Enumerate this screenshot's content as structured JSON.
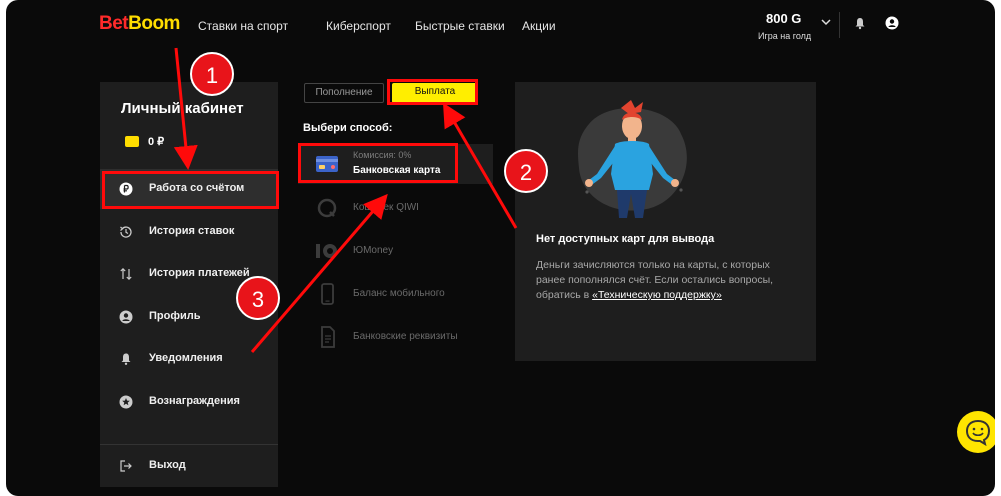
{
  "header": {
    "logo_bet": "Bet",
    "logo_boom": "Boom",
    "nav": [
      "Ставки на спорт",
      "Киберспорт",
      "Быстрые ставки",
      "Акции"
    ],
    "balance_amount": "800 G",
    "balance_sub": "Игра на голд"
  },
  "sidebar": {
    "title": "Личный кабинет",
    "wallet_amount": "0 ₽",
    "items": [
      {
        "label": "Работа со счётом",
        "icon": "ruble-coin-icon"
      },
      {
        "label": "История ставок",
        "icon": "history-icon"
      },
      {
        "label": "История платежей",
        "icon": "transfer-arrows-icon"
      },
      {
        "label": "Профиль",
        "icon": "profile-icon"
      },
      {
        "label": "Уведомления",
        "icon": "bell-icon"
      },
      {
        "label": "Вознаграждения",
        "icon": "star-icon"
      },
      {
        "label": "Выход",
        "icon": "logout-icon"
      }
    ]
  },
  "tabs": {
    "deposit": "Пополнение",
    "withdraw": "Выплата"
  },
  "choose_label": "Выбери способ:",
  "methods": [
    {
      "name": "Банковская карта",
      "fee": "Комиссия: 0%",
      "icon": "bank-card-icon"
    },
    {
      "name": "Кошелек QIWI",
      "icon": "qiwi-icon"
    },
    {
      "name": "ЮMoney",
      "icon": "yoomoney-icon"
    },
    {
      "name": "Баланс мобильного",
      "icon": "mobile-phone-icon"
    },
    {
      "name": "Банковские реквизиты",
      "icon": "document-icon"
    }
  ],
  "panel": {
    "title": "Нет доступных карт для вывода",
    "text": "Деньги зачисляются только на карты, с которых ранее пополнялся счёт. Если остались вопросы, обратись в ",
    "link": "«Техническую поддержку»"
  },
  "annotations": {
    "badge1": "1",
    "badge2": "2",
    "badge3": "3",
    "color": "#ff0a0a"
  },
  "colors": {
    "accent": "#ffdd00",
    "brand_red": "#ff2a2a",
    "background": "#0a0a0a",
    "panel": "#1e1e1e"
  }
}
